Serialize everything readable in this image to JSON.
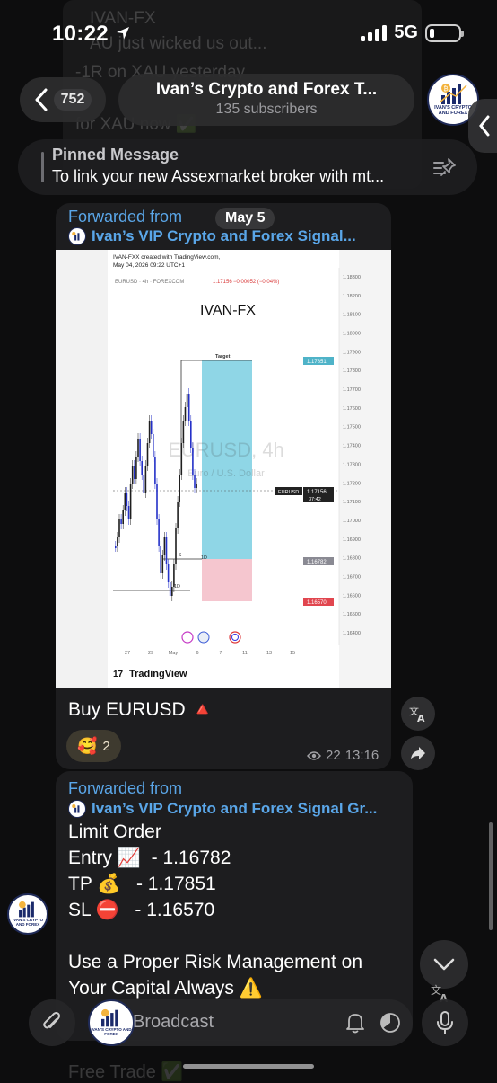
{
  "status": {
    "time": "10:22",
    "network": "5G"
  },
  "background": {
    "lines": [
      "IVAN-FX",
      "AU just wicked us out...",
      "-1R on XAU yesterday",
      "...",
      "for XAU now ✅"
    ],
    "bottom_line": "Free Trade ✅"
  },
  "header": {
    "unread_count": "752",
    "title": "Ivan’s Crypto and Forex T...",
    "subscribers": "135 subscribers",
    "avatar_caption": "IVAN'S CRYPTO AND FOREX"
  },
  "pinned": {
    "title": "Pinned Message",
    "text": "To link your new Assexmarket broker with mt..."
  },
  "message1": {
    "forwarded_label": "Forwarded from",
    "forwarded_from": "Ivan’s VIP Crypto and Forex Signal...",
    "date_chip": "May 5",
    "text": "Buy EURUSD 🔺",
    "reaction_emoji": "🥰",
    "reaction_count": "2",
    "views": "22",
    "time": "13:16"
  },
  "chart": {
    "header_line1": "IVAN-FXX created with TradingView.com,",
    "header_line2": "May 04, 2026 09:22 UTC+1",
    "symbol_line": "EURUSD · 4h · FOREXCOM",
    "price": "1.17156",
    "change": "−0.00052 (−0.04%)",
    "brand": "IVAN-FX",
    "watermark_title": "EURUSD, 4h",
    "watermark_sub": "Euro / U.S. Dollar",
    "target_label": "Target",
    "s_label": "S",
    "d_label_1": "1D",
    "d_label_2": "1D",
    "target_price": "1.17851",
    "current_price": "1.17156",
    "countdown": "37:42",
    "current_tag": "EURUSD",
    "entry_price": "1.16782",
    "stop_price": "1.16570",
    "y_ticks": [
      "1.18300",
      "1.18200",
      "1.18100",
      "1.18000",
      "1.17900",
      "1.17800",
      "1.17700",
      "1.17600",
      "1.17500",
      "1.17400",
      "1.17300",
      "1.17200",
      "1.17100",
      "1.17000",
      "1.16900",
      "1.16800",
      "1.16700",
      "1.16600",
      "1.16500",
      "1.16400"
    ],
    "x_ticks": [
      "27",
      "29",
      "May",
      "6",
      "7",
      "11",
      "13",
      "15"
    ],
    "footer": "TradingView",
    "colors": {
      "target_zone": "#8fd6e6",
      "stop_zone": "#f5c6cf",
      "bull": "#1f1f1f",
      "bear": "#2430c8"
    }
  },
  "message2": {
    "forwarded_label": "Forwarded from",
    "forwarded_from": "Ivan’s VIP Crypto and Forex Signal Gr...",
    "line1": "Limit Order",
    "entry": "Entry 📈  - 1.16782",
    "tp": "TP 💰   - 1.17851",
    "sl": "SL ⛔   - 1.16570",
    "risk1": "Use a Proper Risk Management on",
    "risk2": "Your Capital Always ⚠️"
  },
  "composer": {
    "placeholder": "Broadcast"
  }
}
